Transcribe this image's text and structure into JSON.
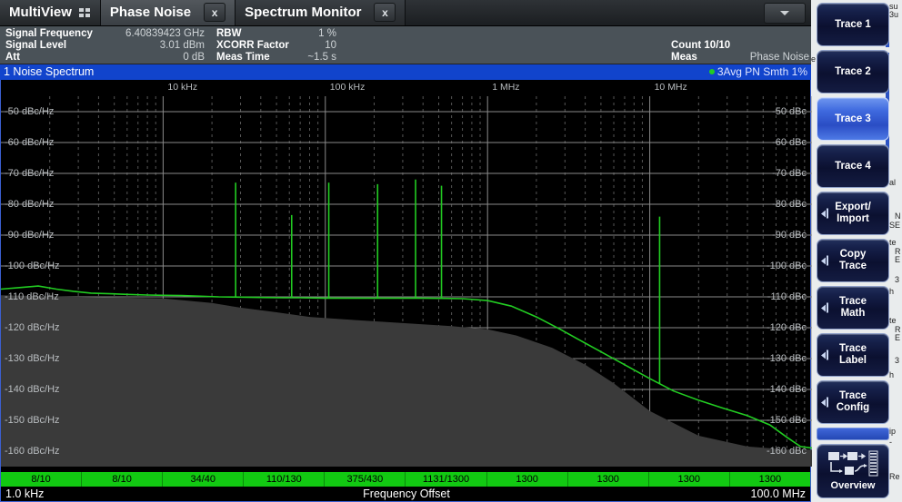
{
  "tabs": [
    {
      "label": "MultiView",
      "icon": "grid-icon",
      "closable": false,
      "state": "multiview"
    },
    {
      "label": "Phase Noise",
      "closable": true,
      "close_label": "x",
      "state": "active"
    },
    {
      "label": "Spectrum Monitor",
      "closable": true,
      "close_label": "x",
      "state": "inactive"
    }
  ],
  "tab_dropdown_icon": "chevron-down-icon",
  "info_header": {
    "rows": [
      {
        "label": "Signal Frequency",
        "value": "6.40839423 GHz"
      },
      {
        "label": "Signal Level",
        "value": "3.01 dBm"
      },
      {
        "label": "Att",
        "value": "0 dB"
      }
    ],
    "rows2": [
      {
        "label": "RBW",
        "value": "1 %"
      },
      {
        "label": "XCORR Factor",
        "value": "10"
      },
      {
        "label": "Meas Time",
        "value": "~1.5 s"
      }
    ],
    "rows3": [
      {
        "label": "",
        "value": ""
      },
      {
        "label": "Count 10/10",
        "value": ""
      },
      {
        "label": "Meas",
        "value": "Phase Noise"
      }
    ]
  },
  "window": {
    "title": "1 Noise Spectrum",
    "trace_legend": "3Avg PN Smth 1%",
    "legend_dot_color": "#22cc22"
  },
  "x_axis": {
    "start_label": "1.0 kHz",
    "center_label": "Frequency Offset",
    "end_label": "100.0 MHz"
  },
  "count_bar": [
    "8/10",
    "8/10",
    "34/40",
    "110/130",
    "375/430",
    "1131/1300",
    "1300",
    "1300",
    "1300",
    "1300"
  ],
  "softkeys": [
    {
      "label": "Trace 1",
      "selected": false,
      "submenu": false
    },
    {
      "label": "Trace 2",
      "selected": false,
      "submenu": false
    },
    {
      "label": "Trace 3",
      "selected": true,
      "submenu": false
    },
    {
      "label": "Trace 4",
      "selected": false,
      "submenu": false
    },
    {
      "label": "Export/\nImport",
      "selected": false,
      "submenu": true
    },
    {
      "label": "Copy\nTrace",
      "selected": false,
      "submenu": true
    },
    {
      "label": "Trace\nMath",
      "selected": false,
      "submenu": true
    },
    {
      "label": "Trace\nLabel",
      "selected": false,
      "submenu": true
    },
    {
      "label": "Trace\nConfig",
      "selected": false,
      "submenu": true
    }
  ],
  "overview_button": {
    "label": "Overview",
    "icon": "workflow-diagram-icon"
  },
  "background_panel": {
    "fragments": [
      "su",
      "3u",
      "e",
      "al",
      "N",
      "SE",
      "te",
      "R",
      "E",
      "3",
      "h",
      "te",
      "R",
      "E",
      "3",
      "h",
      "ip",
      "-",
      "Re"
    ]
  },
  "chart_data": {
    "type": "line",
    "title": "1 Noise Spectrum",
    "xlabel": "Frequency Offset",
    "ylabel": "dBc/Hz",
    "x_scale": "log",
    "xlim": [
      1000,
      100000000
    ],
    "ylim": [
      -165,
      -45
    ],
    "grid": true,
    "x_tick_labels": [
      "10 kHz",
      "100 kHz",
      "1 MHz",
      "10 MHz"
    ],
    "x_tick_values": [
      10000,
      100000,
      1000000,
      10000000
    ],
    "y_tick_labels_left": [
      "-50 dBc/Hz",
      "-60 dBc/Hz",
      "-70 dBc/Hz",
      "-80 dBc/Hz",
      "-90 dBc/Hz",
      "-100 dBc/Hz",
      "-110 dBc/Hz",
      "-120 dBc/Hz",
      "-130 dBc/Hz",
      "-140 dBc/Hz",
      "-150 dBc/Hz",
      "-160 dBc/Hz"
    ],
    "y_tick_labels_right": [
      "-50 dBc",
      "-60 dBc",
      "-70 dBc",
      "-80 dBc",
      "-90 dBc",
      "-100 dBc",
      "-110 dBc",
      "-120 dBc",
      "-130 dBc",
      "-140 dBc",
      "-150 dBc",
      "-160 dBc"
    ],
    "y_tick_values": [
      -50,
      -60,
      -70,
      -80,
      -90,
      -100,
      -110,
      -120,
      -130,
      -140,
      -150,
      -160
    ],
    "series": [
      {
        "name": "3Avg PN Smth 1%",
        "color": "#22cc22",
        "x": [
          1000,
          1300,
          1700,
          2200,
          2800,
          3600,
          4700,
          6000,
          8000,
          10000,
          13000,
          17000,
          22000,
          30000,
          40000,
          55000,
          70000,
          100000,
          140000,
          200000,
          280000,
          400000,
          550000,
          700000,
          1000000,
          1400000,
          2000000,
          2800000,
          4000000,
          5500000,
          7000000,
          10000000,
          14000000,
          20000000,
          28000000,
          40000000,
          55000000,
          70000000,
          85000000,
          100000000
        ],
        "y": [
          -107.5,
          -107.0,
          -106.5,
          -107.5,
          -108.2,
          -108.8,
          -109.0,
          -109.2,
          -109.4,
          -109.5,
          -109.6,
          -109.8,
          -110.0,
          -110.1,
          -110.2,
          -110.3,
          -110.3,
          -110.4,
          -110.4,
          -110.4,
          -110.4,
          -110.4,
          -110.5,
          -110.6,
          -111.2,
          -113.0,
          -116.5,
          -120.5,
          -125.0,
          -129.0,
          -132.0,
          -136.5,
          -140.5,
          -143.5,
          -146.0,
          -148.5,
          -151.5,
          -155.5,
          -158.5,
          -159.0
        ]
      }
    ],
    "spurs": [
      {
        "x": 28000,
        "y": -73.0
      },
      {
        "x": 62000,
        "y": -83.5
      },
      {
        "x": 105000,
        "y": -73.0
      },
      {
        "x": 210000,
        "y": -73.5
      },
      {
        "x": 360000,
        "y": -72.0
      },
      {
        "x": 520000,
        "y": -74.0
      },
      {
        "x": 11500000,
        "y": -84.0
      }
    ],
    "noise_floor_band": {
      "description": "shaded grey region below measured curve",
      "color": "#3a3a3a",
      "x": [
        1000,
        3000,
        10000,
        20000,
        30000,
        50000,
        80000,
        150000,
        300000,
        600000,
        1000000,
        1500000,
        2500000,
        4000000,
        6000000,
        10000000,
        20000000,
        40000000,
        70000000,
        100000000
      ],
      "y": [
        -109.5,
        -110.0,
        -110.5,
        -112.0,
        -113.5,
        -115.0,
        -116.5,
        -117.5,
        -118.5,
        -119.5,
        -120.5,
        -122.5,
        -126.5,
        -132.0,
        -138.0,
        -147.0,
        -155.0,
        -158.5,
        -159.5,
        -159.5
      ]
    }
  }
}
